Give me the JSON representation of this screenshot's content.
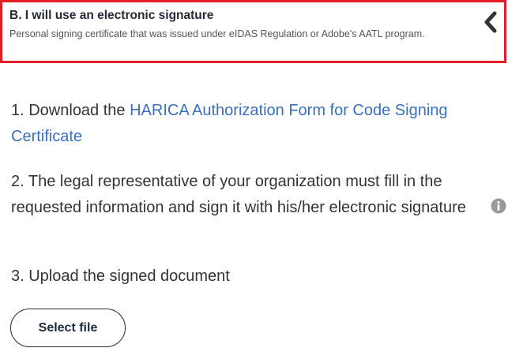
{
  "accordion": {
    "title": "B. I will use an electronic signature",
    "subtitle": "Personal signing certificate that was issued under eIDAS Regulation or Adobe's AATL program.",
    "toggle_icon": "chevron-left-icon",
    "border_color": "#e31e24"
  },
  "steps": {
    "step1_prefix": "1. Download the ",
    "step1_link": "HARICA Authorization Form for Code Signing Certificate",
    "step2": "2. The legal representative of your organization must fill in the requested information and sign it with his/her electronic signature",
    "step3": "3. Upload the signed document"
  },
  "info_icon": "info-icon",
  "upload": {
    "button_label": "Select file"
  },
  "colors": {
    "link": "#3b6fc0",
    "text": "#333333",
    "heading": "#222b36"
  }
}
